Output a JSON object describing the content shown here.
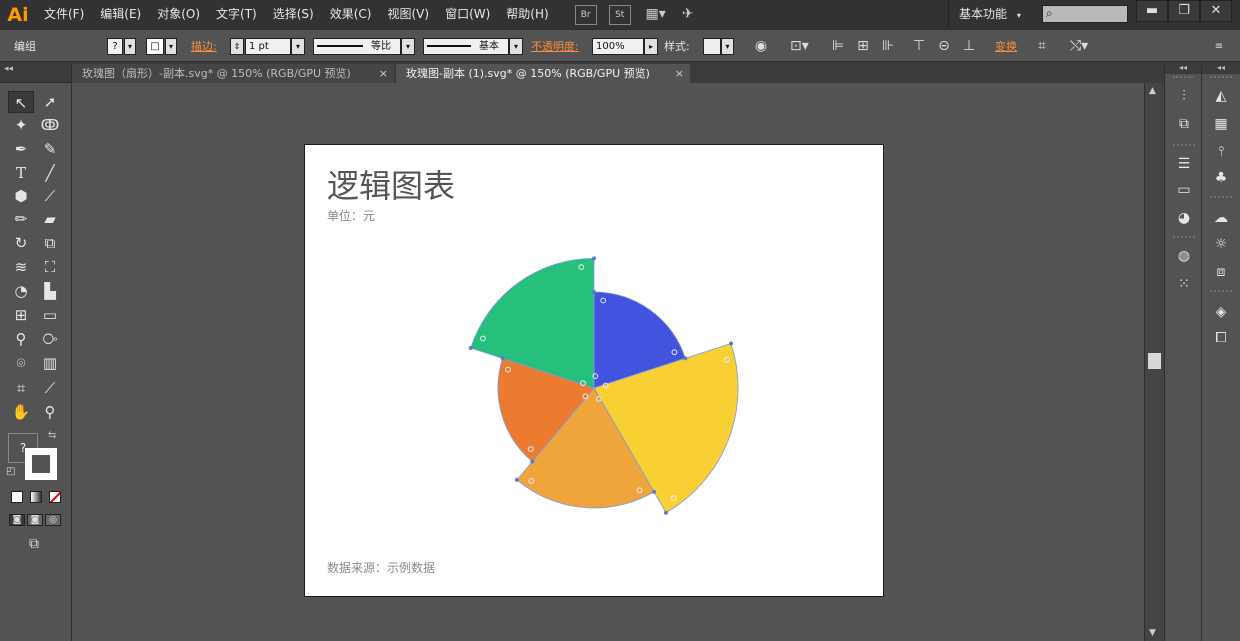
{
  "app": {
    "logo": "Ai",
    "menu": [
      "文件(F)",
      "编辑(E)",
      "对象(O)",
      "文字(T)",
      "选择(S)",
      "效果(C)",
      "视图(V)",
      "窗口(W)",
      "帮助(H)"
    ],
    "bridge_icon_label": "Br",
    "stock_icon_label": "St",
    "workspace_label": "基本功能",
    "search_icon": "magnifier-icon"
  },
  "controlbar": {
    "selection_label": "编组",
    "stroke_link": "描边:",
    "stroke_weight": "1 pt",
    "profile_label": "等比",
    "brush_label": "基本",
    "opacity_link": "不透明度:",
    "opacity_value": "100%",
    "style_label": "样式:",
    "transform_link": "变换"
  },
  "tabs": [
    {
      "label": "玫瑰图（扇形）-副本.svg* @ 150% (RGB/GPU 预览)",
      "active": false
    },
    {
      "label": "玫瑰图-副本 (1).svg* @ 150% (RGB/GPU 预览)",
      "active": true
    }
  ],
  "tab_close_glyph": "×",
  "artboard": {
    "title": "逻辑图表",
    "unit": "单位：元",
    "source": "数据来源：示例数据"
  },
  "chart_data": {
    "type": "rose",
    "series_colors": [
      "#4253e0",
      "#f8d034",
      "#f0a53c",
      "#ec7a2f",
      "#27bf7c"
    ],
    "values": [
      1,
      1.5,
      1.25,
      1,
      1.35
    ],
    "title": "逻辑图表"
  },
  "colors": {
    "app_accent": "#ff9a00",
    "link_orange": "#ff8d3a",
    "ui_dark": "#323232",
    "ui_mid": "#535353",
    "selection_point": "#5b78d8"
  }
}
